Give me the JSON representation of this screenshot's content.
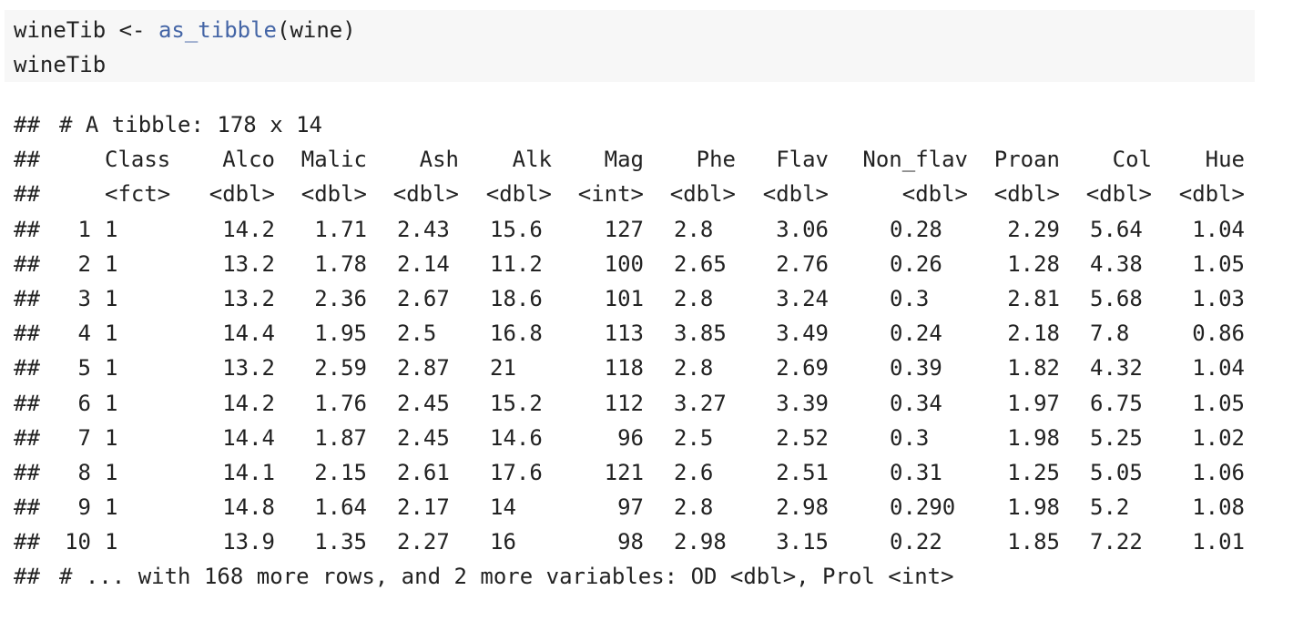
{
  "code": {
    "line1_var": "wineTib <- ",
    "line1_fn": "as_tibble",
    "line1_args": "(wine)",
    "line2": "wineTib"
  },
  "output": {
    "prefix": "##",
    "header": "# A tibble: 178 x 14",
    "columns": [
      "Class",
      "Alco",
      "Malic",
      "Ash",
      "Alk",
      "Mag",
      "Phe",
      "Flav",
      "Non_flav",
      "Proan",
      "Col",
      "Hue"
    ],
    "types": [
      "<fct>",
      "<dbl>",
      "<dbl>",
      "<dbl>",
      "<dbl>",
      "<int>",
      "<dbl>",
      "<dbl>",
      "<dbl>",
      "<dbl>",
      "<dbl>",
      "<dbl>"
    ],
    "rows": [
      [
        "1",
        "1",
        "14.2",
        "1.71",
        "2.43",
        "15.6",
        "127",
        "2.8",
        "3.06",
        "0.28",
        "2.29",
        "5.64",
        "1.04"
      ],
      [
        "2",
        "1",
        "13.2",
        "1.78",
        "2.14",
        "11.2",
        "100",
        "2.65",
        "2.76",
        "0.26",
        "1.28",
        "4.38",
        "1.05"
      ],
      [
        "3",
        "1",
        "13.2",
        "2.36",
        "2.67",
        "18.6",
        "101",
        "2.8",
        "3.24",
        "0.3",
        "2.81",
        "5.68",
        "1.03"
      ],
      [
        "4",
        "1",
        "14.4",
        "1.95",
        "2.5",
        "16.8",
        "113",
        "3.85",
        "3.49",
        "0.24",
        "2.18",
        "7.8",
        "0.86"
      ],
      [
        "5",
        "1",
        "13.2",
        "2.59",
        "2.87",
        "21",
        "118",
        "2.8",
        "2.69",
        "0.39",
        "1.82",
        "4.32",
        "1.04"
      ],
      [
        "6",
        "1",
        "14.2",
        "1.76",
        "2.45",
        "15.2",
        "112",
        "3.27",
        "3.39",
        "0.34",
        "1.97",
        "6.75",
        "1.05"
      ],
      [
        "7",
        "1",
        "14.4",
        "1.87",
        "2.45",
        "14.6",
        "96",
        "2.5",
        "2.52",
        "0.3",
        "1.98",
        "5.25",
        "1.02"
      ],
      [
        "8",
        "1",
        "14.1",
        "2.15",
        "2.61",
        "17.6",
        "121",
        "2.6",
        "2.51",
        "0.31",
        "1.25",
        "5.05",
        "1.06"
      ],
      [
        "9",
        "1",
        "14.8",
        "1.64",
        "2.17",
        "14",
        "97",
        "2.8",
        "2.98",
        "0.290",
        "1.98",
        "5.2",
        "1.08"
      ],
      [
        "10",
        "1",
        "13.9",
        "1.35",
        "2.27",
        "16",
        "98",
        "2.98",
        "3.15",
        "0.22",
        "1.85",
        "7.22",
        "1.01"
      ]
    ],
    "footer": "# ... with 168 more rows, and 2 more variables: OD <dbl>, Prol <int>"
  }
}
